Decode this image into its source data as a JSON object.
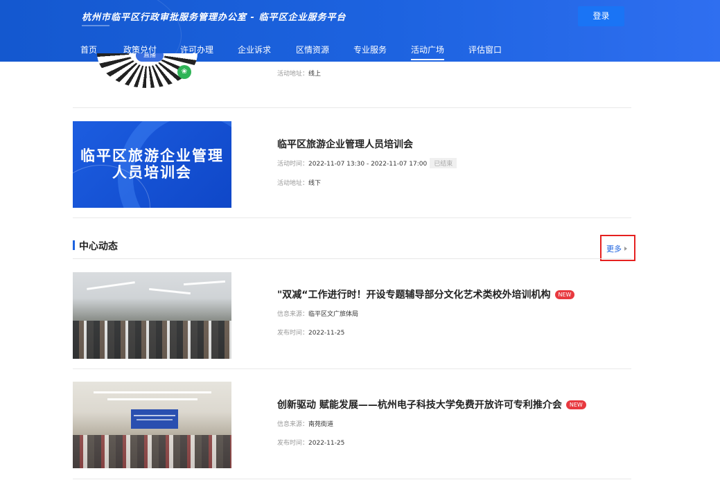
{
  "header": {
    "site_title": "杭州市临平区行政审批服务管理办公室 - 临平区企业服务平台",
    "login_label": "登录",
    "nav": [
      {
        "label": "首页"
      },
      {
        "label": "政策兑付"
      },
      {
        "label": "许可办理"
      },
      {
        "label": "企业诉求"
      },
      {
        "label": "区情资源"
      },
      {
        "label": "专业服务"
      },
      {
        "label": "活动广场",
        "active": true
      },
      {
        "label": "评估窗口"
      }
    ]
  },
  "activities": [
    {
      "qr_center_label": "直播",
      "address_label": "活动地址：",
      "address": "线上"
    },
    {
      "banner_text": "临平区旅游企业管理人员培训会",
      "title": "临平区旅游企业管理人员培训会",
      "time_label": "活动时间：",
      "time": "2022-11-07 13:30 - 2022-11-07 17:00",
      "status": "已结束",
      "address_label": "活动地址：",
      "address": "线下"
    }
  ],
  "center_news": {
    "section_title": "中心动态",
    "more_label": "更多",
    "items": [
      {
        "title": "\"双减“工作进行时！开设专题辅导部分文化艺术类校外培训机构",
        "badge": "NEW",
        "source_label": "信息来源：",
        "source": "临平区文广旅体局",
        "date_label": "发布时间：",
        "date": "2022-11-25"
      },
      {
        "title": "创新驱动 赋能发展——杭州电子科技大学免费开放许可专利推介会",
        "badge": "NEW",
        "source_label": "信息来源：",
        "source": "南苑街道",
        "date_label": "发布时间：",
        "date": "2022-11-25"
      }
    ]
  },
  "colors": {
    "header_blue": "#1d63e0",
    "login_button": "#1a74f5",
    "new_badge": "#e8393f",
    "highlight_border": "#e5201f"
  }
}
